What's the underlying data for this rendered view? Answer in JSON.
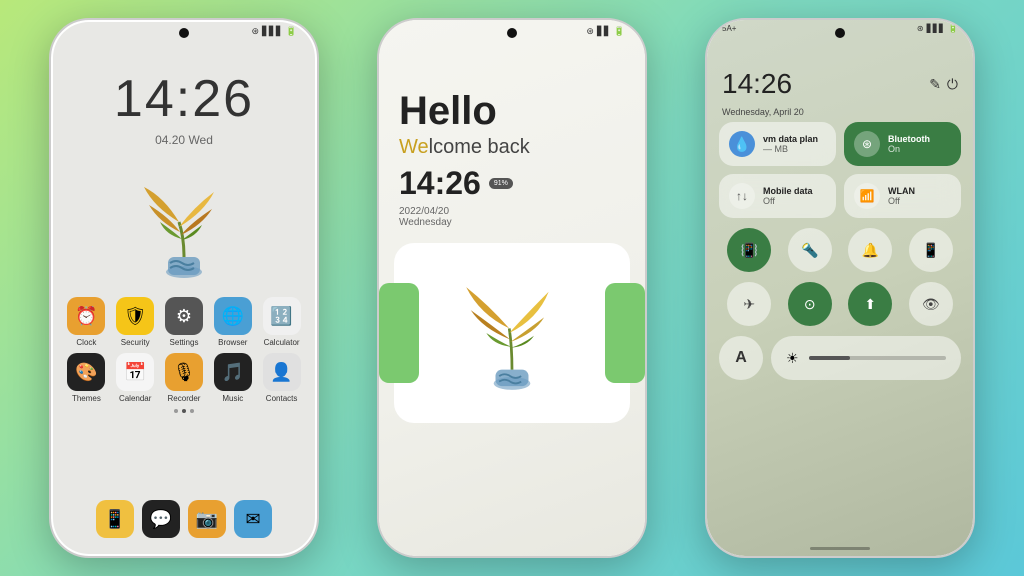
{
  "background": {
    "gradient": "linear-gradient(135deg, #b8e87a, #7dd9c0, #5bc8d8)"
  },
  "phone1": {
    "clock": "14:26",
    "date": "04.20  Wed",
    "apps_row1": [
      {
        "label": "Clock",
        "color": "#e8a030",
        "icon": "⏰"
      },
      {
        "label": "Security",
        "color": "#f5c518",
        "icon": "🛡"
      },
      {
        "label": "Settings",
        "color": "#555",
        "icon": "⚙️"
      },
      {
        "label": "Browser",
        "color": "#4a9fd4",
        "icon": "🌐"
      },
      {
        "label": "Calculator",
        "color": "#f0f0f0",
        "icon": "🔢"
      }
    ],
    "apps_row2": [
      {
        "label": "Themes",
        "color": "#222",
        "icon": "🎨"
      },
      {
        "label": "Calendar",
        "color": "#f0f0f0",
        "icon": "📅"
      },
      {
        "label": "Recorder",
        "color": "#e8a030",
        "icon": "🎙"
      },
      {
        "label": "Music",
        "color": "#222",
        "icon": "🎵"
      },
      {
        "label": "Contacts",
        "color": "#e0e0e0",
        "icon": "👤"
      }
    ],
    "bottom_apps": [
      {
        "icon": "📱",
        "color": "#f0c040"
      },
      {
        "icon": "💬",
        "color": "#222"
      },
      {
        "icon": "📷",
        "color": "#e8a030"
      },
      {
        "icon": "✉️",
        "color": "#4a9fd4"
      }
    ]
  },
  "phone2": {
    "hello": "Hello",
    "welcome": "Welcome back",
    "we_colored": "We",
    "lcome": "lcome back",
    "time": "14:26",
    "battery": "91%",
    "date": "2022/04/20",
    "day": "Wednesday"
  },
  "phone3": {
    "time": "14:26",
    "date": "Wednesday, April 20",
    "status_left": "5A+",
    "tile1_label": "vm data plan",
    "tile1_sub": "— MB",
    "tile2_label": "Bluetooth",
    "tile2_sub": "On",
    "tile3_label": "Mobile data",
    "tile3_sub": "Off",
    "tile4_label": "WLAN",
    "tile4_sub": "Off",
    "buttons_row1": [
      "vibrate",
      "flashlight",
      "bell",
      "screenshot"
    ],
    "buttons_row2": [
      "airplane",
      "coin",
      "location",
      "eye"
    ],
    "font_label": "A",
    "brightness_icon": "☀"
  }
}
